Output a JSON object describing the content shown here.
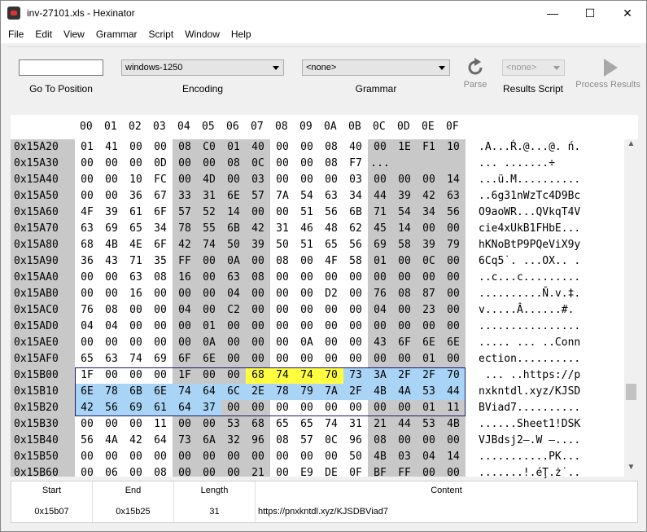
{
  "window": {
    "title": "inv-27101.xls - Hexinator",
    "minimize": "—",
    "maximize": "☐",
    "close": "✕"
  },
  "menu": [
    "File",
    "Edit",
    "View",
    "Grammar",
    "Script",
    "Window",
    "Help"
  ],
  "toolbar": {
    "goto_value": "",
    "goto_label": "Go To Position",
    "encoding_value": "windows-1250",
    "encoding_label": "Encoding",
    "grammar_value": "<none>",
    "grammar_label": "Grammar",
    "parse_label": "Parse",
    "results_script_value": "<none>",
    "results_script_label": "Results Script",
    "process_label": "Process Results"
  },
  "hex": {
    "columns": [
      "00",
      "01",
      "02",
      "03",
      "04",
      "05",
      "06",
      "07",
      "08",
      "09",
      "0A",
      "0B",
      "0C",
      "0D",
      "0E",
      "0F"
    ],
    "highlight_colors": {
      "yellow": "#ffff40",
      "blue": "#aad4f5",
      "border": "#1a1a6e"
    },
    "rows": [
      {
        "offset": "0x15A20",
        "bytes": [
          "01",
          "41",
          "00",
          "00",
          "08",
          "C0",
          "01",
          "40",
          "00",
          "00",
          "08",
          "40",
          "00",
          "1E",
          "F1",
          "10"
        ],
        "ascii": ".A...Ŕ.@...@. ń."
      },
      {
        "offset": "0x15A30",
        "bytes": [
          "00",
          "00",
          "00",
          "0D",
          "00",
          "00",
          "08",
          "0C",
          "00",
          "00",
          "08",
          "F7",
          "...",
          "",
          "",
          " "
        ],
        "ascii": "... .......÷"
      },
      {
        "offset": "0x15A40",
        "bytes": [
          "00",
          "00",
          "10",
          "FC",
          "00",
          "4D",
          "00",
          "03",
          "00",
          "00",
          "00",
          "03",
          "00",
          "00",
          "00",
          "14"
        ],
        "ascii": "...ü.M.........."
      },
      {
        "offset": "0x15A50",
        "bytes": [
          "00",
          "00",
          "36",
          "67",
          "33",
          "31",
          "6E",
          "57",
          "7A",
          "54",
          "63",
          "34",
          "44",
          "39",
          "42",
          "63"
        ],
        "ascii": "..6g31nWzTc4D9Bc"
      },
      {
        "offset": "0x15A60",
        "bytes": [
          "4F",
          "39",
          "61",
          "6F",
          "57",
          "52",
          "14",
          "00",
          "00",
          "51",
          "56",
          "6B",
          "71",
          "54",
          "34",
          "56"
        ],
        "ascii": "O9aoWR...QVkqT4V"
      },
      {
        "offset": "0x15A70",
        "bytes": [
          "63",
          "69",
          "65",
          "34",
          "78",
          "55",
          "6B",
          "42",
          "31",
          "46",
          "48",
          "62",
          "45",
          "14",
          "00",
          "00"
        ],
        "ascii": "cie4xUkB1FHbE..."
      },
      {
        "offset": "0x15A80",
        "bytes": [
          "68",
          "4B",
          "4E",
          "6F",
          "42",
          "74",
          "50",
          "39",
          "50",
          "51",
          "65",
          "56",
          "69",
          "58",
          "39",
          "79"
        ],
        "ascii": "hKNoBtP9PQeViX9y"
      },
      {
        "offset": "0x15A90",
        "bytes": [
          "36",
          "43",
          "71",
          "35",
          "FF",
          "00",
          "0A",
          "00",
          "08",
          "00",
          "4F",
          "58",
          "01",
          "00",
          "0C",
          "00"
        ],
        "ascii": "6Cq5˙. ...OX.. ."
      },
      {
        "offset": "0x15AA0",
        "bytes": [
          "00",
          "00",
          "63",
          "08",
          "16",
          "00",
          "63",
          "08",
          "00",
          "00",
          "00",
          "00",
          "00",
          "00",
          "00",
          "00"
        ],
        "ascii": "..c...c........."
      },
      {
        "offset": "0x15AB0",
        "bytes": [
          "00",
          "00",
          "16",
          "00",
          "00",
          "00",
          "04",
          "00",
          "00",
          "00",
          "D2",
          "00",
          "76",
          "08",
          "87",
          "00"
        ],
        "ascii": "..........Ň.v.‡."
      },
      {
        "offset": "0x15AC0",
        "bytes": [
          "76",
          "08",
          "00",
          "00",
          "04",
          "00",
          "C2",
          "00",
          "00",
          "00",
          "00",
          "00",
          "04",
          "00",
          "23",
          "00"
        ],
        "ascii": "v.....Â......#."
      },
      {
        "offset": "0x15AD0",
        "bytes": [
          "04",
          "04",
          "00",
          "00",
          "00",
          "01",
          "00",
          "00",
          "00",
          "00",
          "00",
          "00",
          "00",
          "00",
          "00",
          "00"
        ],
        "ascii": "................"
      },
      {
        "offset": "0x15AE0",
        "bytes": [
          "00",
          "00",
          "00",
          "00",
          "00",
          "0A",
          "00",
          "00",
          "00",
          "0A",
          "00",
          "00",
          "43",
          "6F",
          "6E",
          "6E"
        ],
        "ascii": "..... ... ..Conn"
      },
      {
        "offset": "0x15AF0",
        "bytes": [
          "65",
          "63",
          "74",
          "69",
          "6F",
          "6E",
          "00",
          "00",
          "00",
          "00",
          "00",
          "00",
          "00",
          "00",
          "01",
          "00"
        ],
        "ascii": "ection.........."
      },
      {
        "offset": "0x15B00",
        "bytes": [
          "1F",
          "00",
          "00",
          "00",
          "1F",
          "00",
          "00",
          "68",
          "74",
          "74",
          "70",
          "73",
          "3A",
          "2F",
          "2F",
          "70"
        ],
        "ascii": " ... ..https://p"
      },
      {
        "offset": "0x15B10",
        "bytes": [
          "6E",
          "78",
          "6B",
          "6E",
          "74",
          "64",
          "6C",
          "2E",
          "78",
          "79",
          "7A",
          "2F",
          "4B",
          "4A",
          "53",
          "44"
        ],
        "ascii": "nxkntdl.xyz/KJSD"
      },
      {
        "offset": "0x15B20",
        "bytes": [
          "42",
          "56",
          "69",
          "61",
          "64",
          "37",
          "00",
          "00",
          "00",
          "00",
          "00",
          "00",
          "00",
          "00",
          "01",
          "11"
        ],
        "ascii": "BViad7.........."
      },
      {
        "offset": "0x15B30",
        "bytes": [
          "00",
          "00",
          "00",
          "11",
          "00",
          "00",
          "53",
          "68",
          "65",
          "65",
          "74",
          "31",
          "21",
          "44",
          "53",
          "4B"
        ],
        "ascii": "......Sheet1!DSK"
      },
      {
        "offset": "0x15B40",
        "bytes": [
          "56",
          "4A",
          "42",
          "64",
          "73",
          "6A",
          "32",
          "96",
          "08",
          "57",
          "0C",
          "96",
          "08",
          "00",
          "00",
          "00"
        ],
        "ascii": "VJBdsj2–.W –...."
      },
      {
        "offset": "0x15B50",
        "bytes": [
          "00",
          "00",
          "00",
          "00",
          "00",
          "00",
          "00",
          "00",
          "00",
          "00",
          "00",
          "50",
          "4B",
          "03",
          "04",
          "14"
        ],
        "ascii": "...........PK..."
      },
      {
        "offset": "0x15B60",
        "bytes": [
          "00",
          "06",
          "00",
          "08",
          "00",
          "00",
          "00",
          "21",
          "00",
          "E9",
          "DE",
          "0F",
          "BF",
          "FF",
          "00",
          "00"
        ],
        "ascii": ".......!.éŢ.ż˙.."
      }
    ]
  },
  "results": {
    "headers": {
      "start": "Start",
      "end": "End",
      "length": "Length",
      "content": "Content"
    },
    "start": "0x15b07",
    "end": "0x15b25",
    "length": "31",
    "content": "https://pnxkntdl.xyz/KJSDBViad7"
  }
}
